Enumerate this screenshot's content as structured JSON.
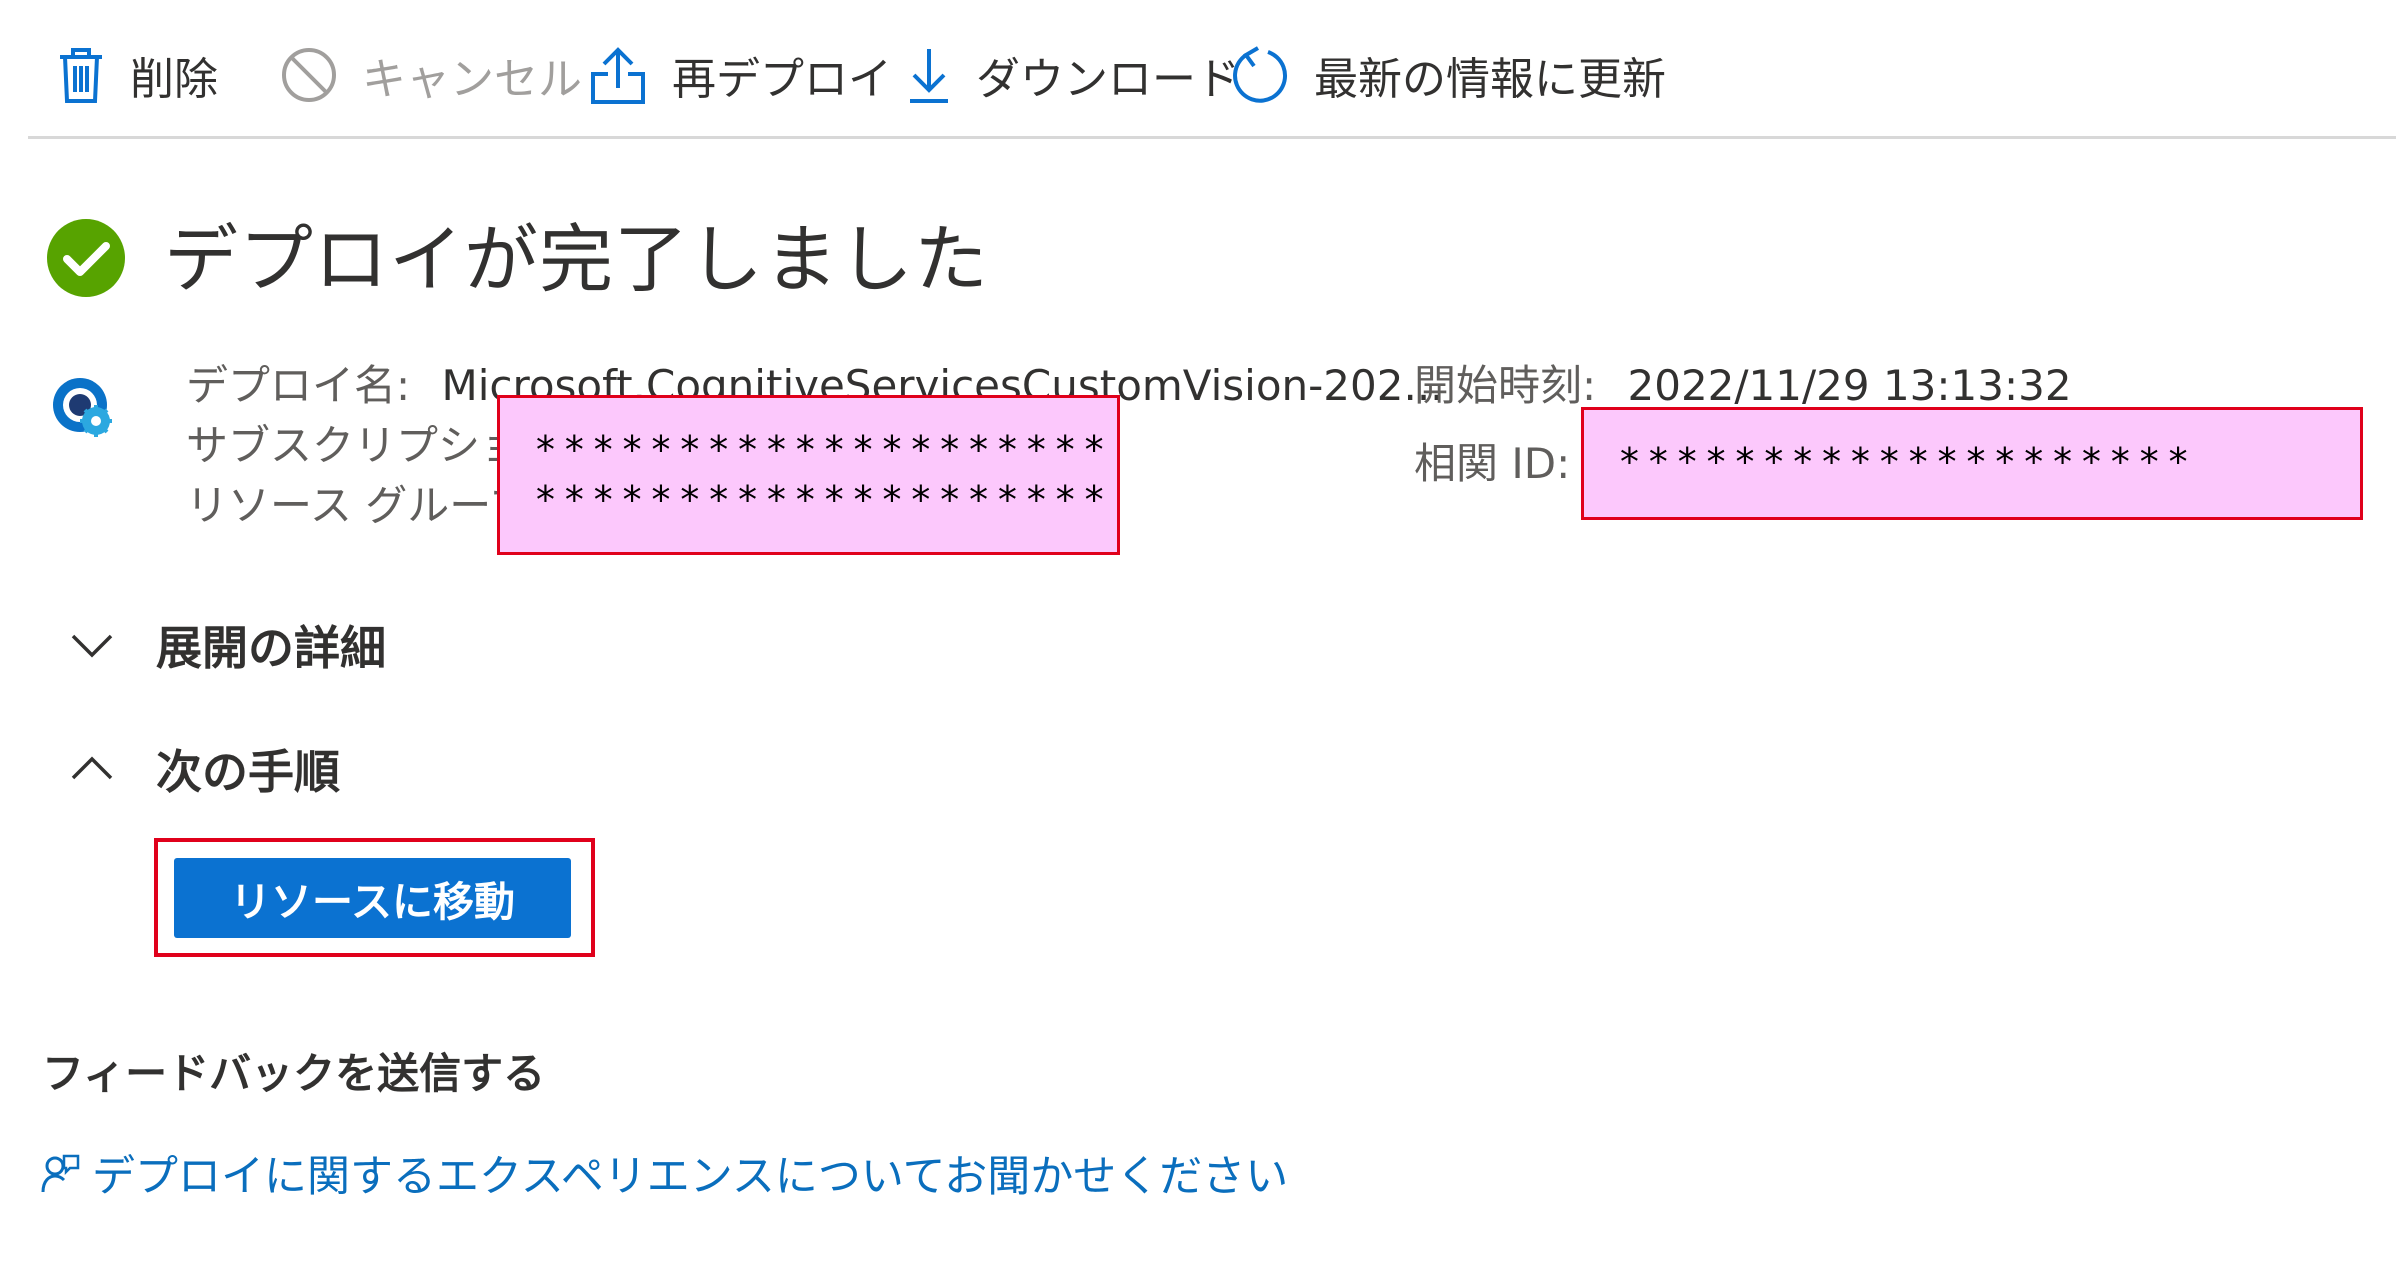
{
  "toolbar": {
    "delete_label": "削除",
    "cancel_label": "キャンセル",
    "redeploy_label": "再デプロイ",
    "download_label": "ダウンロード",
    "refresh_label": "最新の情報に更新",
    "icons": [
      "trash-icon",
      "cancel-icon",
      "upload-icon",
      "download-icon",
      "refresh-icon"
    ]
  },
  "status": {
    "title": "デプロイが完了しました",
    "icon": "check-circle-icon",
    "color": "#57a300"
  },
  "details": {
    "deployment_name_label": "デプロイ名:",
    "deployment_name_value": "Microsoft.CognitiveServicesCustomVision-202...",
    "subscription_label": "サブスクリプション:",
    "subscription_value": "********************",
    "resource_group_label": "リソース グループ:",
    "resource_group_value": "********************",
    "start_time_label": "開始時刻:",
    "start_time_value": "2022/11/29 13:13:32",
    "correlation_id_label": "相関 ID:",
    "correlation_id_value": "********************"
  },
  "sections": {
    "deployment_details_label": "展開の詳細",
    "next_steps_label": "次の手順",
    "go_to_resource_label": "リソースに移動"
  },
  "feedback": {
    "title": "フィードバックを送信する",
    "link_text": "デプロイに関するエクスペリエンスについてお聞かせください"
  },
  "colors": {
    "accent": "#0b72d1",
    "link": "#0a6ebd",
    "redaction_fill": "#fcc8fc",
    "highlight_border": "#e0001b"
  }
}
